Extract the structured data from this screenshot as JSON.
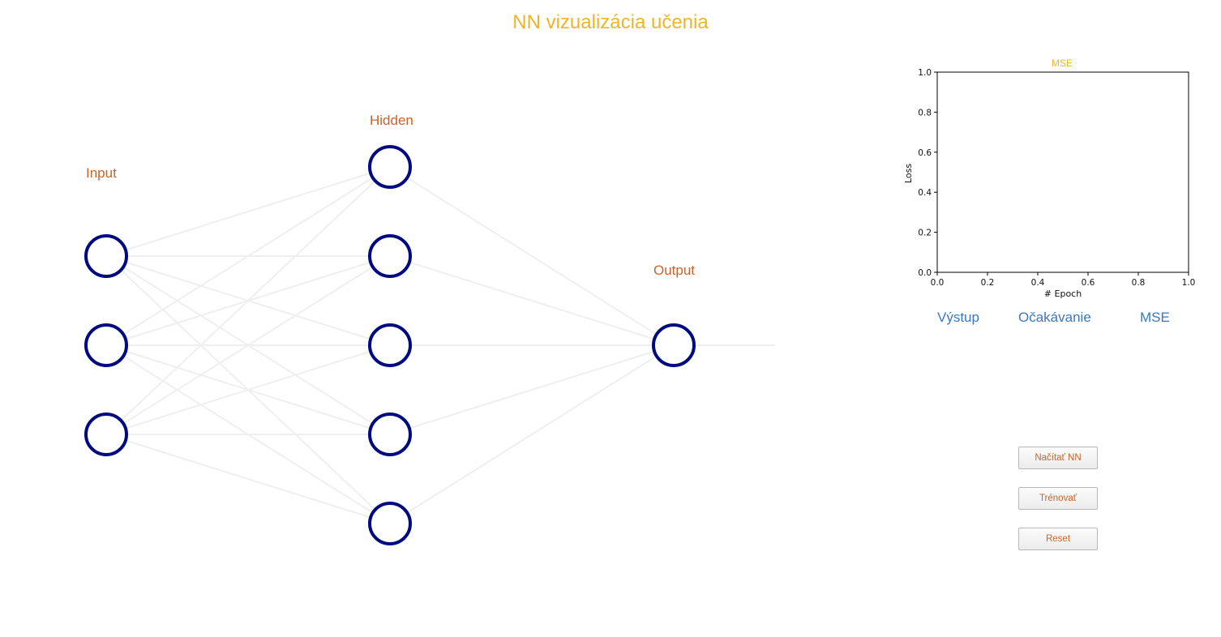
{
  "app": {
    "title": "NN vizualizácia učenia"
  },
  "network": {
    "layers": [
      {
        "label": "Input",
        "nodes": 3
      },
      {
        "label": "Hidden",
        "nodes": 5
      },
      {
        "label": "Output",
        "nodes": 1
      }
    ]
  },
  "chart_data": {
    "type": "line",
    "title": "MSE",
    "xlabel": "# Epoch",
    "ylabel": "Loss",
    "xlim": [
      0,
      1
    ],
    "ylim": [
      0,
      1
    ],
    "x_ticks": [
      "0.0",
      "0.2",
      "0.4",
      "0.6",
      "0.8",
      "1.0"
    ],
    "y_ticks": [
      "0.0",
      "0.2",
      "0.4",
      "0.6",
      "0.8",
      "1.0"
    ],
    "series": []
  },
  "results": {
    "output_header": "Výstup",
    "expected_header": "Očakávanie",
    "mse_header": "MSE"
  },
  "controls": {
    "load_label": "Načítať NN",
    "train_label": "Trénovať",
    "reset_label": "Reset"
  },
  "colors": {
    "title": "#f0b429",
    "layer_label": "#c8642a",
    "node_stroke": "#000a80",
    "edge": "#efefef",
    "header": "#3b78c0"
  }
}
